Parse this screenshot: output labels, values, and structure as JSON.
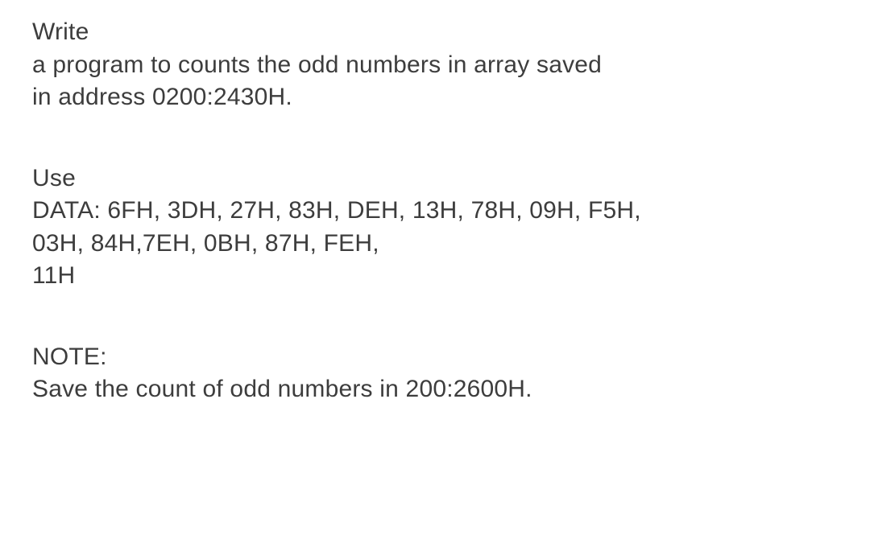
{
  "section1": {
    "line1": "Write",
    "line2": "a program to counts the odd numbers in array saved",
    "line3": "in address 0200:2430H."
  },
  "section2": {
    "line1": "Use",
    "line2": "DATA: 6FH, 3DH, 27H, 83H, DEH, 13H, 78H, 09H, F5H,",
    "line3": "03H, 84H,7EH, 0BH, 87H, FEH,",
    "line4": "11H"
  },
  "section3": {
    "line1": "NOTE:",
    "line2": "Save the count of odd numbers in 200:2600H."
  }
}
